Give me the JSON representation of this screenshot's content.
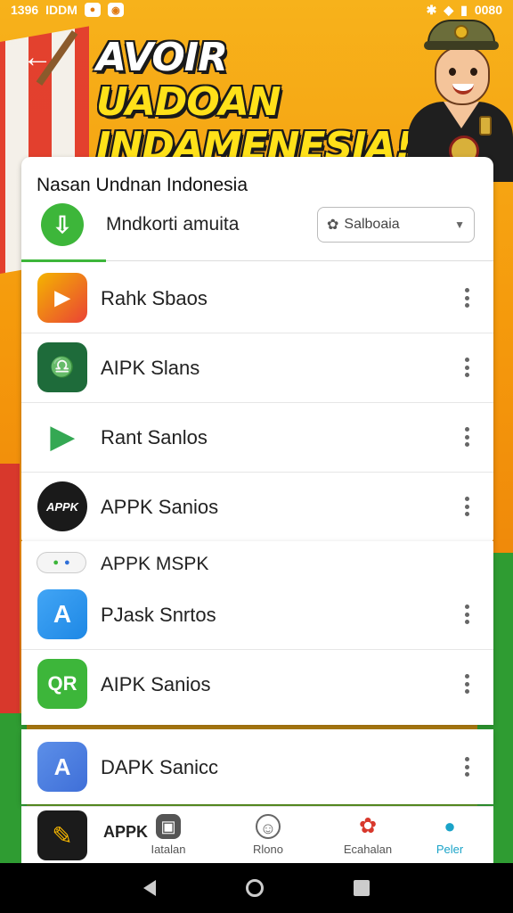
{
  "status_bar": {
    "time": "1396",
    "carrier": "IDDM",
    "right_text": "0080"
  },
  "banner": {
    "title_line1_a": "AVOIR",
    "title_line1_b": "UADOAN",
    "title_line2": "INDAMENESIA!"
  },
  "card": {
    "title": "Nasan Undnan Indonesia",
    "search_label": "Mndkorti amuita",
    "dropdown_value": "Salboaia"
  },
  "apps": [
    {
      "name": "Rahk Sbaos",
      "color": "#f4b400"
    },
    {
      "name": "AIPK Slans",
      "color": "#1e6b3a"
    },
    {
      "name": "Rant Sanlos",
      "color": "#ffffff"
    },
    {
      "name": "APPK Sanios",
      "color": "#ffffff"
    }
  ],
  "section": {
    "label": "APPK MSPK"
  },
  "apps2": [
    {
      "name": "PJask Snrtos",
      "color": "#1e88e5"
    },
    {
      "name": "AIPK  Sanios",
      "color": "#3db63a"
    }
  ],
  "apps3": [
    {
      "name": "DAPK Sanicc",
      "color": "#3f6fd8"
    }
  ],
  "bottom_nav": {
    "app_label": "APPK",
    "items": [
      {
        "label": "Iatalan",
        "icon": "grid-icon"
      },
      {
        "label": "Rlono",
        "icon": "face-icon"
      },
      {
        "label": "Ecahalan",
        "icon": "flower-icon"
      },
      {
        "label": "Peler",
        "icon": "person-icon",
        "active": true
      }
    ]
  },
  "colors": {
    "accent_green": "#3db63a",
    "active_blue": "#1aa3c8",
    "banner_yellow": "#ffe119"
  }
}
